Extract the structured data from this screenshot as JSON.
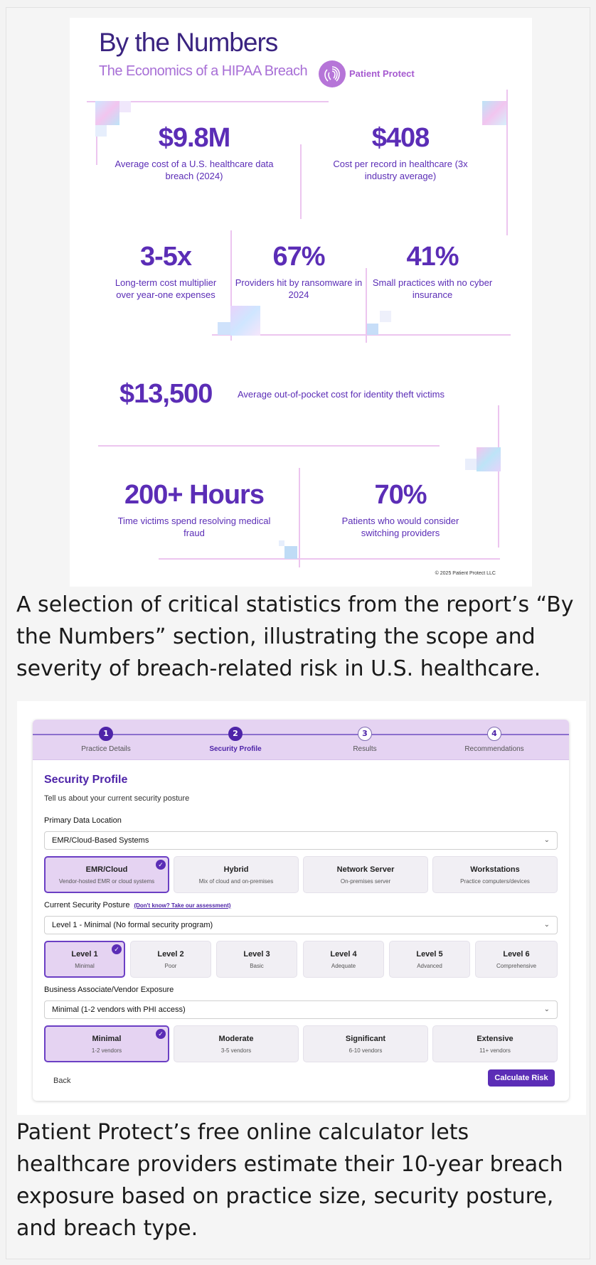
{
  "infographic": {
    "title": "By the Numbers",
    "subtitle": "The Economics of a HIPAA Breach",
    "brand": "Patient Protect",
    "stats": [
      {
        "value": "$9.8M",
        "label": "Average cost of a U.S. healthcare data breach (2024)"
      },
      {
        "value": "$408",
        "label": "Cost per record in healthcare (3x industry average)"
      },
      {
        "value": "3-5x",
        "label": "Long-term cost multiplier over year-one expenses"
      },
      {
        "value": "67%",
        "label": "Providers hit by ransomware in 2024"
      },
      {
        "value": "41%",
        "label": "Small practices with no cyber insurance"
      },
      {
        "value": "$13,500",
        "label": "Average out-of-pocket cost for identity theft victims"
      },
      {
        "value": "200+ Hours",
        "label": "Time victims spend resolving medical fraud"
      },
      {
        "value": "70%",
        "label": "Patients who would consider switching providers"
      }
    ],
    "copyright": "© 2025 Patient Protect LLC"
  },
  "caption1": "A selection of critical statistics from the report’s “By the Numbers” section, illustrating the scope and severity of breach-related risk in U.S. healthcare.",
  "form": {
    "steps": [
      {
        "num": "1",
        "label": "Practice Details"
      },
      {
        "num": "2",
        "label": "Security Profile"
      },
      {
        "num": "3",
        "label": "Results"
      },
      {
        "num": "4",
        "label": "Recommendations"
      }
    ],
    "title": "Security Profile",
    "subtitle": "Tell us about your current security posture",
    "data_location": {
      "label": "Primary Data Location",
      "selected": "EMR/Cloud-Based Systems",
      "options": [
        {
          "title": "EMR/Cloud",
          "desc": "Vendor-hosted EMR or cloud systems"
        },
        {
          "title": "Hybrid",
          "desc": "Mix of cloud and on-premises"
        },
        {
          "title": "Network Server",
          "desc": "On-premises server"
        },
        {
          "title": "Workstations",
          "desc": "Practice computers/devices"
        }
      ]
    },
    "posture": {
      "label": "Current Security Posture",
      "link": "(Don't know? Take our assessment)",
      "selected": "Level 1 - Minimal (No formal security program)",
      "options": [
        {
          "title": "Level 1",
          "desc": "Minimal"
        },
        {
          "title": "Level 2",
          "desc": "Poor"
        },
        {
          "title": "Level 3",
          "desc": "Basic"
        },
        {
          "title": "Level 4",
          "desc": "Adequate"
        },
        {
          "title": "Level 5",
          "desc": "Advanced"
        },
        {
          "title": "Level 6",
          "desc": "Comprehensive"
        }
      ]
    },
    "vendor": {
      "label": "Business Associate/Vendor Exposure",
      "selected": "Minimal (1-2 vendors with PHI access)",
      "options": [
        {
          "title": "Minimal",
          "desc": "1-2 vendors"
        },
        {
          "title": "Moderate",
          "desc": "3-5 vendors"
        },
        {
          "title": "Significant",
          "desc": "6-10 vendors"
        },
        {
          "title": "Extensive",
          "desc": "11+ vendors"
        }
      ]
    },
    "back_label": "Back",
    "calc_label": "Calculate Risk",
    "check_glyph": "✓",
    "chevron_glyph": "⌄"
  },
  "caption2": "Patient Protect’s free online calculator lets healthcare providers estimate their 10-year breach exposure based on practice size, security posture, and breach type.",
  "colors": {
    "accent": "#5b2db6",
    "lavender": "#e5d3f2",
    "pink_line": "#ecc5ef"
  }
}
